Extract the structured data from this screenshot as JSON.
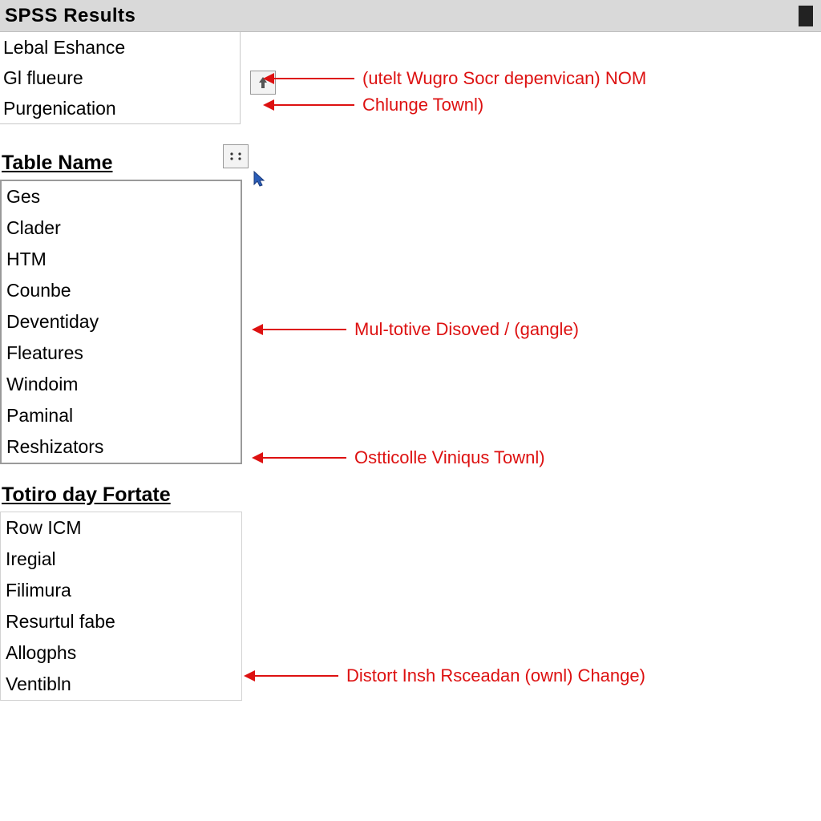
{
  "window": {
    "title": "SPSS  Results"
  },
  "toplist": {
    "items": [
      "Lebal Eshance",
      "Gl flueure",
      "Purgenication"
    ]
  },
  "buttons": {
    "up_icon": "arrow-up-icon",
    "dots_icon": "dots-icon",
    "cursor_icon": "cursor-icon"
  },
  "sections": [
    {
      "heading": "Table Name",
      "items": [
        "Ges",
        "Clader",
        "HTM",
        "Counbe",
        "Deventiday",
        "Fleatures",
        "Windoim",
        "Paminal",
        "Reshizators"
      ]
    },
    {
      "heading": "Totiro day Fortate",
      "items": [
        "Row ICM",
        "Iregial",
        "Filimura",
        "Resurtul fabe",
        "Allogphs",
        "Ventibln"
      ]
    }
  ],
  "annotations": [
    {
      "text": "(utelt Wugro Socr depenvican) NOM"
    },
    {
      "text": "Chlunge Townl)"
    },
    {
      "text": "Mul-totive Disoved / (gangle)"
    },
    {
      "text": "Ostticolle Viniqus Townl)"
    },
    {
      "text": "Distort Insh Rsceadan (ownl) Change)"
    }
  ]
}
